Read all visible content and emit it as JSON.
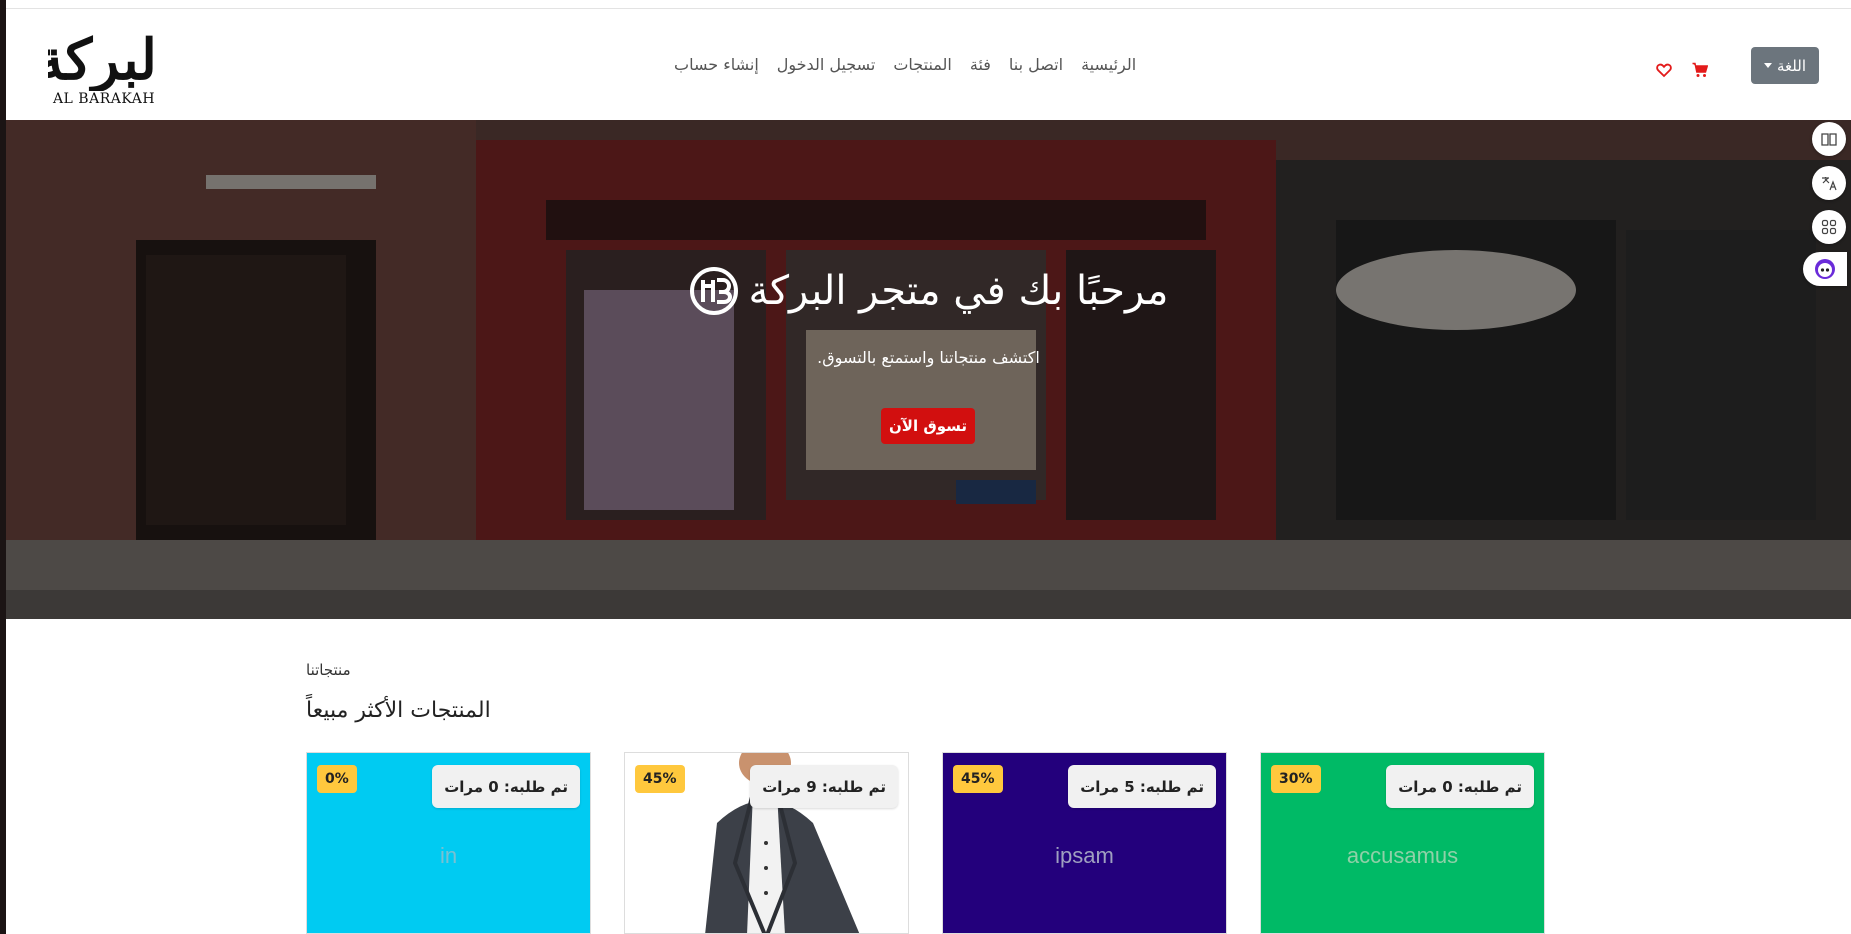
{
  "brand": {
    "name_ar": "البركة",
    "name_en": "AL BARAKAH"
  },
  "nav": {
    "links": [
      "إنشاء حساب",
      "تسجيل الدخول",
      "المنتجات",
      "فئة",
      "اتصل بنا",
      "الرئيسية"
    ],
    "language_label": "اللغة"
  },
  "icons": {
    "wishlist": "heart-icon",
    "cart": "cart-icon"
  },
  "hero": {
    "title": "مرحبًا بك في متجر البركة",
    "subtitle": "اكتشف منتجاتنا واستمتع بالتسوق.",
    "cta": "تسوق الآن"
  },
  "side_tools": [
    "book-icon",
    "translate-icon",
    "apps-icon",
    "assistant-icon"
  ],
  "products_section": {
    "label": "منتجاتنا",
    "title": "المنتجات الأكثر مبيعاً"
  },
  "products": [
    {
      "name": "in",
      "orders": "تم طلبه: 0 مرات",
      "discount": "0%",
      "bg": "#00cbf2",
      "name_color": "#7ac0d2"
    },
    {
      "name": "",
      "orders": "تم طلبه: 9 مرات",
      "discount": "45%",
      "bg": "#ffffff",
      "name_color": "#999999"
    },
    {
      "name": "ipsam",
      "orders": "تم طلبه: 5 مرات",
      "discount": "45%",
      "bg": "#23007c",
      "name_color": "#9fa0c0"
    },
    {
      "name": "accusamus",
      "orders": "تم طلبه: 0 مرات",
      "discount": "30%",
      "bg": "#00ba66",
      "name_color": "#8fd0a8"
    }
  ],
  "colors": {
    "accent_red": "#d20f0f",
    "lang_button": "#6c757d",
    "badge_yellow": "#ffc83d"
  }
}
